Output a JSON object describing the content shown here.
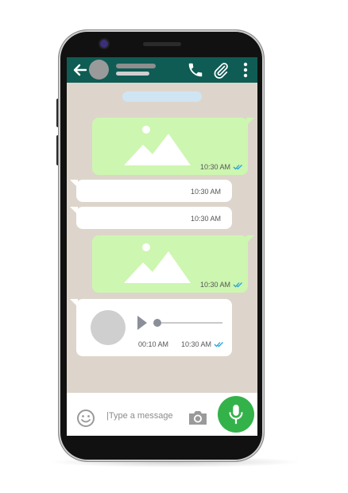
{
  "colors": {
    "header": "#0e5c54",
    "chat_background": "#ddd5cb",
    "outgoing_bubble": "#cdf6b0",
    "incoming_bubble": "#ffffff",
    "read_ticks": "#2aa4d6",
    "mic_button": "#33b24a"
  },
  "header": {
    "back_icon": "arrow-left-icon",
    "call_icon": "phone-icon",
    "attach_icon": "paperclip-icon",
    "menu_icon": "more-vertical-icon"
  },
  "messages": [
    {
      "type": "image",
      "direction": "outgoing",
      "time": "10:30 AM",
      "status": "read"
    },
    {
      "type": "text",
      "direction": "incoming",
      "time": "10:30 AM"
    },
    {
      "type": "text",
      "direction": "incoming",
      "time": "10:30 AM"
    },
    {
      "type": "image",
      "direction": "outgoing",
      "time": "10:30 AM",
      "status": "read"
    },
    {
      "type": "voice",
      "direction": "incoming",
      "duration": "00:10 AM",
      "time": "10:30 AM",
      "status": "read"
    }
  ],
  "composer": {
    "placeholder": "|Type a message",
    "emoji_icon": "emoji-icon",
    "camera_icon": "camera-icon",
    "mic_icon": "mic-icon"
  }
}
